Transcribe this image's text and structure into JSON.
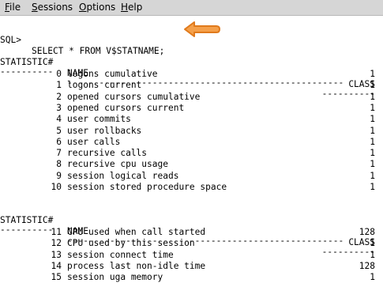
{
  "menu": {
    "items": [
      {
        "label_u": "F",
        "label_rest": "ile"
      },
      {
        "label_u": "S",
        "label_rest": "essions"
      },
      {
        "label_u": "O",
        "label_rest": "ptions"
      },
      {
        "label_u": "H",
        "label_rest": "elp"
      }
    ]
  },
  "terminal": {
    "prompt": "SQL>",
    "command": "SELECT * FROM V$STATNAME;",
    "headers": {
      "statistic": "STATISTIC#",
      "name": "NAME",
      "class": "CLASS"
    },
    "separators": {
      "statistic": "----------",
      "name": "----------------------------------------------------",
      "class": "----------"
    },
    "block1": [
      {
        "num": "0",
        "name": "logons cumulative",
        "cls": "1"
      },
      {
        "num": "1",
        "name": "logons current",
        "cls": "1"
      },
      {
        "num": "2",
        "name": "opened cursors cumulative",
        "cls": "1"
      },
      {
        "num": "3",
        "name": "opened cursors current",
        "cls": "1"
      },
      {
        "num": "4",
        "name": "user commits",
        "cls": "1"
      },
      {
        "num": "5",
        "name": "user rollbacks",
        "cls": "1"
      },
      {
        "num": "6",
        "name": "user calls",
        "cls": "1"
      },
      {
        "num": "7",
        "name": "recursive calls",
        "cls": "1"
      },
      {
        "num": "8",
        "name": "recursive cpu usage",
        "cls": "1"
      },
      {
        "num": "9",
        "name": "session logical reads",
        "cls": "1"
      },
      {
        "num": "10",
        "name": "session stored procedure space",
        "cls": "1"
      }
    ],
    "block2": [
      {
        "num": "11",
        "name": "CPU used when call started",
        "cls": "128"
      },
      {
        "num": "12",
        "name": "CPU used by this session",
        "cls": "1"
      },
      {
        "num": "13",
        "name": "session connect time",
        "cls": "1"
      },
      {
        "num": "14",
        "name": "process last non-idle time",
        "cls": "128"
      },
      {
        "num": "15",
        "name": "session uga memory",
        "cls": "1"
      }
    ]
  },
  "colors": {
    "arrow_fill": "#f5a04a",
    "arrow_stroke": "#e07a1c"
  },
  "icons": {
    "arrow": "left-pointing-arrow-icon"
  }
}
